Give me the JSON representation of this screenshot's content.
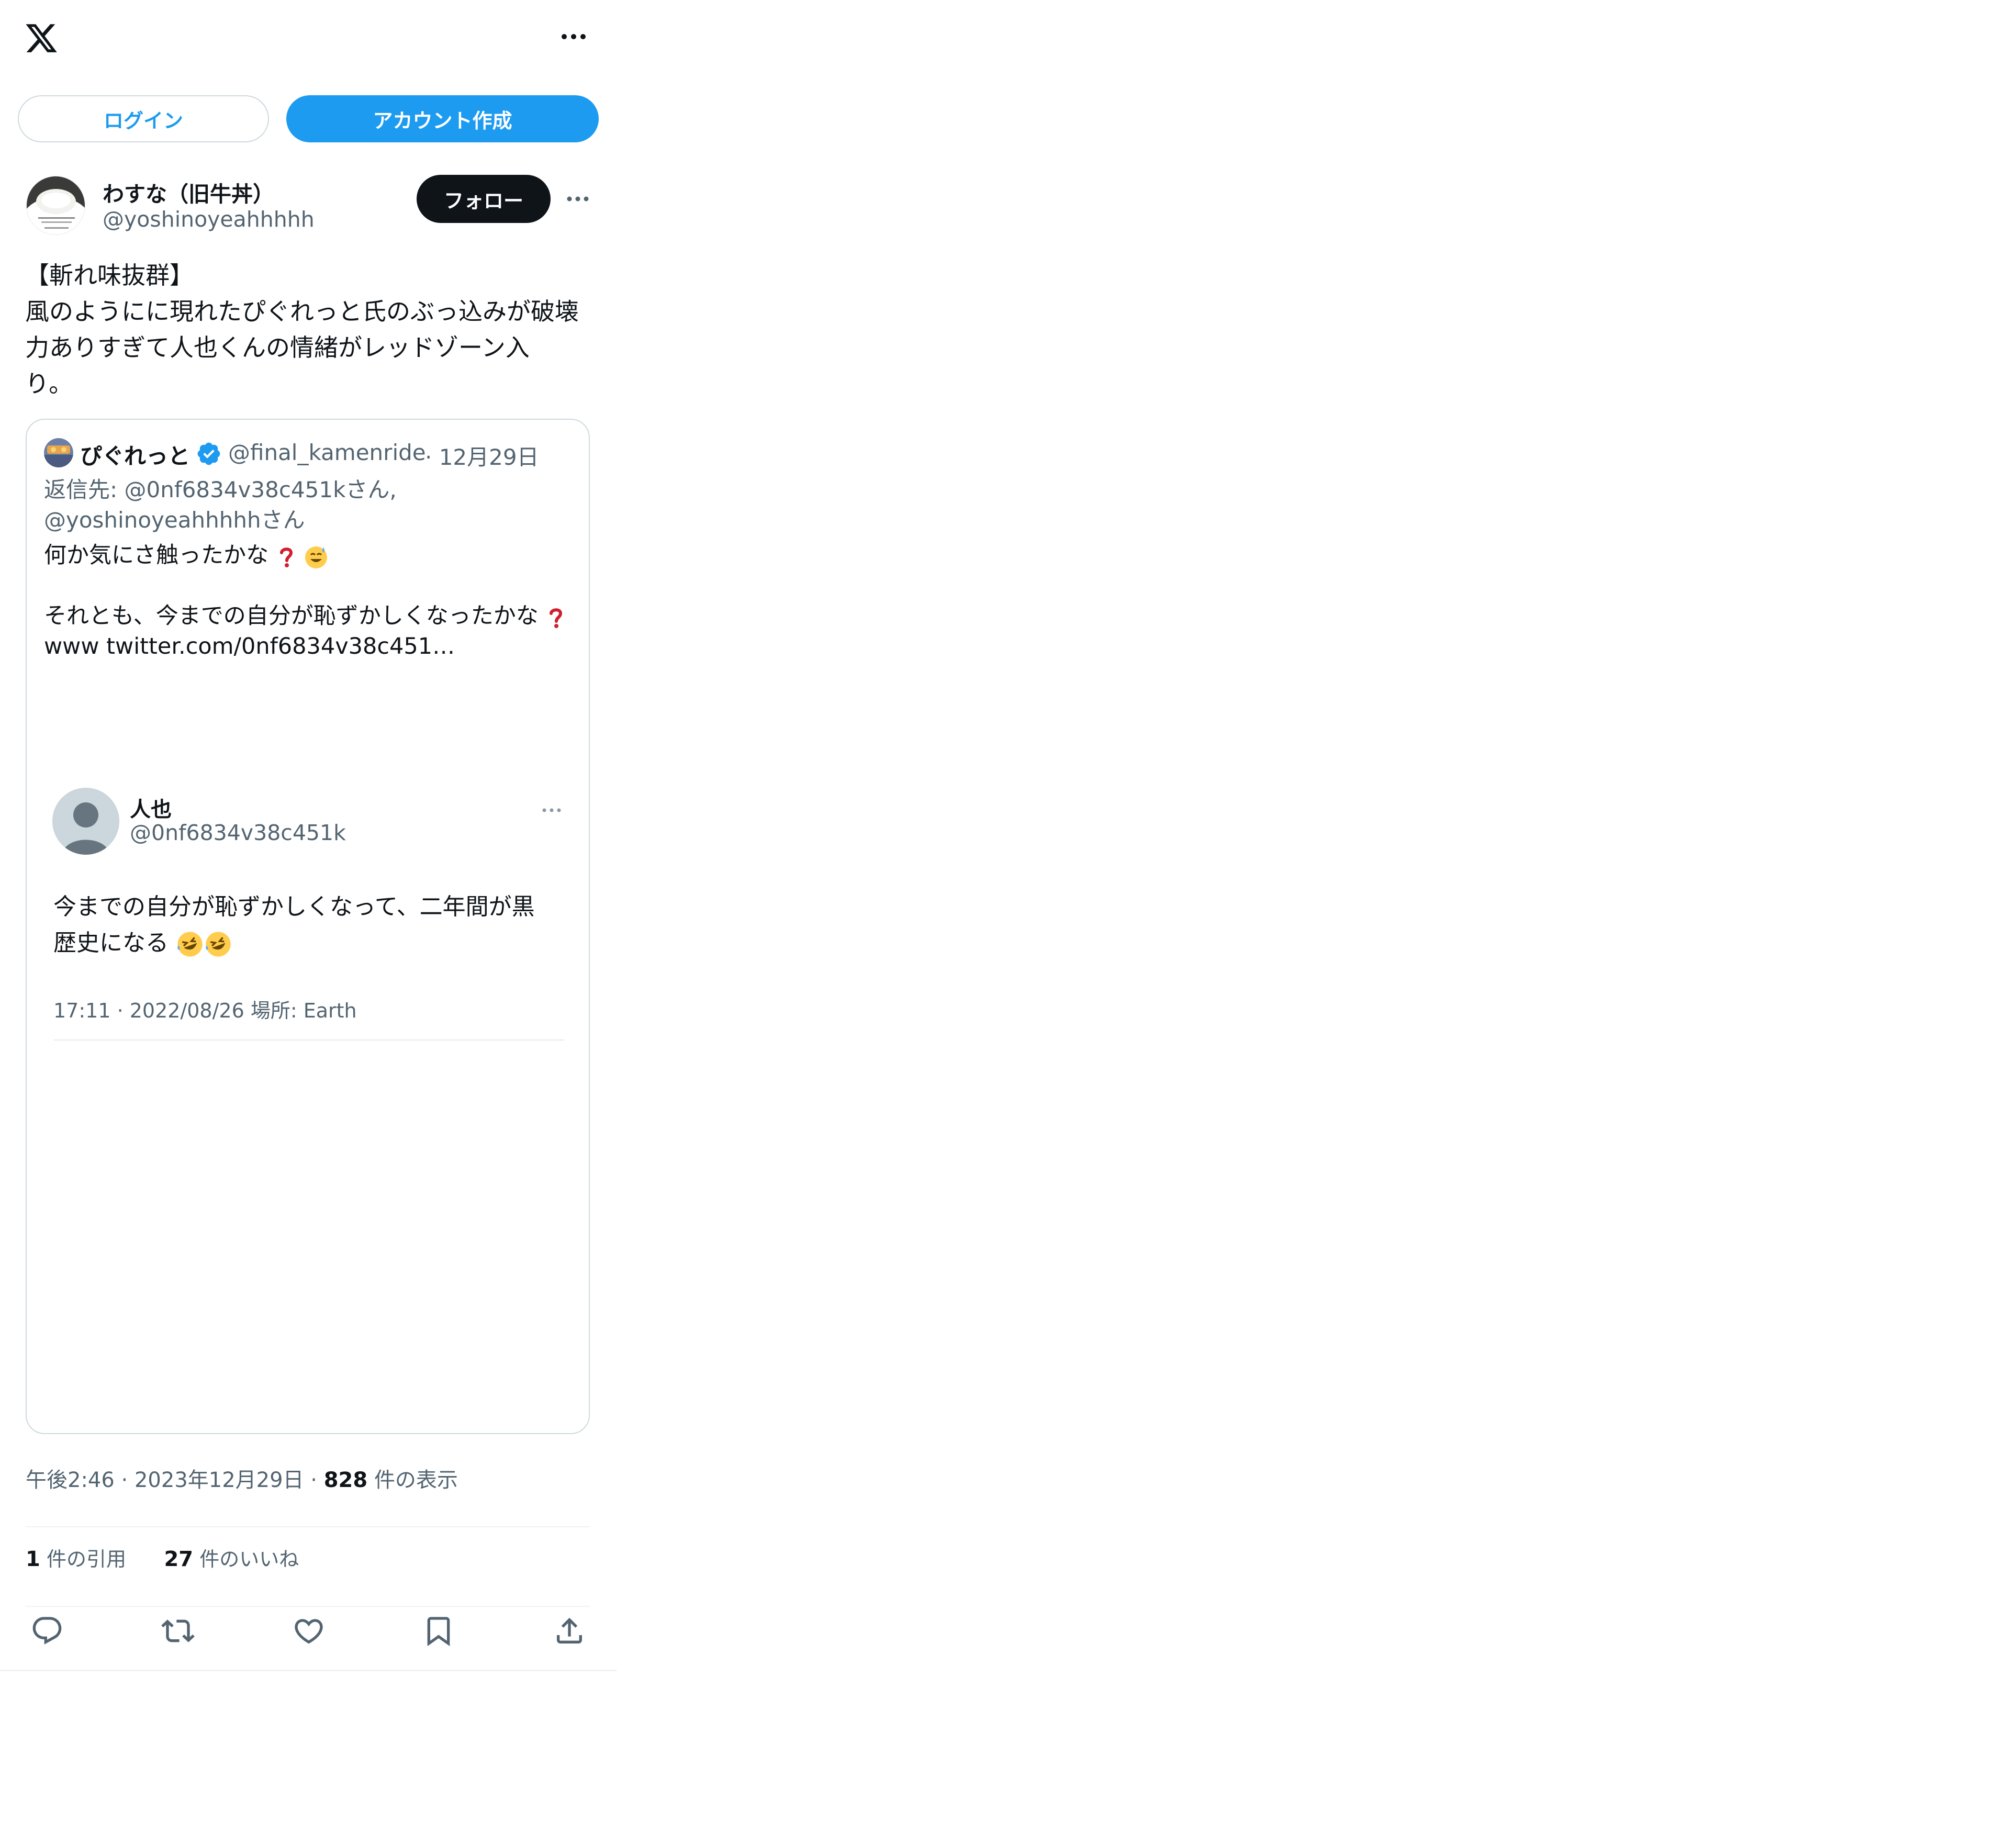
{
  "header": {
    "logo_icon": "x-logo-icon",
    "more_icon": "more-horizontal-icon"
  },
  "auth": {
    "login_label": "ログイン",
    "create_account_label": "アカウント作成"
  },
  "tweet": {
    "author_name": "わすな（旧牛丼）",
    "author_handle": "@yoshinoyeahhhhh",
    "follow_label": "フォロー",
    "text": "【斬れ味抜群】\n風のようにに現れたぴぐれっと氏のぶっ込みが破壊\n力ありすぎて人也くんの情緒がレッドゾーン入\nり。",
    "posted_at": "午後2:46 · 2023年12月29日 ·",
    "views_count": "828",
    "views_label": "件の表示",
    "quotes_count": "1",
    "quotes_label": "件の引用",
    "likes_count": "27",
    "likes_label": "件のいいね"
  },
  "quote": {
    "author_name": "ぴぐれっと",
    "author_handle": "@final_kamenride",
    "date": "· 12月29日",
    "reply_line1": "返信先: @0nf6834v38c451kさん,",
    "reply_line2": "@yoshinoyeahhhhhさん",
    "line1": "何か気にさ触ったかな",
    "line2": "それとも、今までの自分が恥ずかしくなったかな",
    "line3": "www  twitter.com/0nf6834v38c451…"
  },
  "embedded": {
    "author_name": "人也",
    "author_handle": "@0nf6834v38c451k",
    "text_line1": "今までの自分が恥ずかしくなって、二年間が黒",
    "text_line2": "歴史になる",
    "meta": "17:11 · 2022/08/26 場所: Earth"
  },
  "actions": [
    "reply-icon",
    "retweet-icon",
    "like-icon",
    "bookmark-icon",
    "share-icon"
  ],
  "colors": {
    "accent": "#1d9bf0",
    "text": "#0f1419",
    "muted": "#536471",
    "border": "#cfd9de"
  }
}
